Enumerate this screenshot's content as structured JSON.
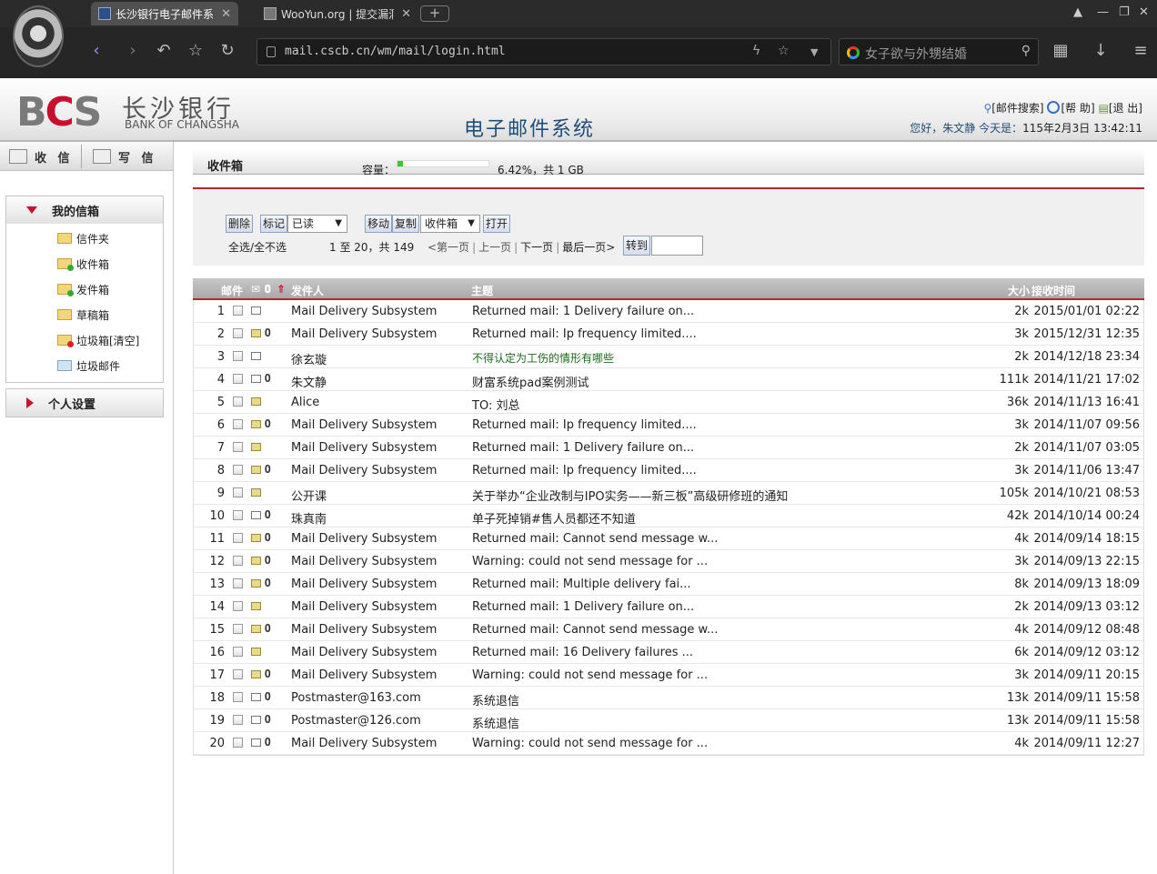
{
  "browser": {
    "tabs": [
      {
        "title": "长沙银行电子邮件系统",
        "active": true
      },
      {
        "title": "WooYun.org | 提交漏洞",
        "active": false
      }
    ],
    "url": "mail.cscb.cn/wm/mail/login.html",
    "search_text": "女子欲与外甥结婚"
  },
  "header": {
    "logo_en": "BANK OF CHANGSHA",
    "logo_cn": "长沙银行",
    "logo_bcs": "BCS",
    "system_title": "电子邮件系统",
    "links": {
      "search": "[邮件搜索]",
      "help": "[帮 助]",
      "logout": "[退 出]"
    },
    "greeting": "您好，朱文静 今天是：",
    "date": "115年2月3日 13:42:11"
  },
  "sidebar": {
    "receive": "收 信",
    "compose": "写 信",
    "mybox_title": "我的信箱",
    "folders": [
      {
        "label": "信件夹",
        "kind": "plain"
      },
      {
        "label": "收件箱",
        "kind": "green"
      },
      {
        "label": "发件箱",
        "kind": "green"
      },
      {
        "label": "草稿箱",
        "kind": "plain"
      },
      {
        "label": "垃圾箱[清空]",
        "kind": "red"
      },
      {
        "label": "垃圾邮件",
        "kind": "blue"
      }
    ],
    "settings_title": "个人设置"
  },
  "main": {
    "title": "收件箱",
    "capacity_label": "容量：",
    "capacity_percent": 6.42,
    "capacity_text": "6.42%，共 1 GB",
    "toolbar": {
      "delete": "删除",
      "mark": "标记",
      "mark_option": "已读",
      "move": "移动",
      "copy": "复制",
      "folder_option": "收件箱",
      "open": "打开",
      "select_all": "全选/全不选",
      "range": "1 至 20，共 149",
      "first": "<第一页",
      "prev": "上一页",
      "next": "下一页",
      "last": "最后一页>",
      "goto": "转到"
    },
    "columns": {
      "mail": "邮件",
      "sender": "发件人",
      "subject": "主题",
      "size": "大小",
      "time": "接收时间"
    },
    "rows": [
      {
        "n": "1",
        "read": true,
        "attach": false,
        "from": "Mail Delivery Subsystem",
        "subject": "Returned mail: 1 Delivery failure on...",
        "size": "2k",
        "time": "2015/01/01 02:22"
      },
      {
        "n": "2",
        "read": false,
        "attach": true,
        "from": "Mail Delivery Subsystem",
        "subject": "Returned mail: Ip frequency limited....",
        "size": "3k",
        "time": "2015/12/31 12:35"
      },
      {
        "n": "3",
        "read": true,
        "attach": false,
        "from": "徐玄璇",
        "subject": "不得认定为工伤的情形有哪些",
        "size": "2k",
        "time": "2014/12/18 23:34",
        "green": true
      },
      {
        "n": "4",
        "read": true,
        "attach": true,
        "from": "朱文静",
        "subject": "财富系统pad案例测试",
        "size": "111k",
        "time": "2014/11/21 17:02"
      },
      {
        "n": "5",
        "read": false,
        "attach": false,
        "from": "Alice",
        "subject": "TO: 刘总",
        "size": "36k",
        "time": "2014/11/13 16:41"
      },
      {
        "n": "6",
        "read": false,
        "attach": true,
        "from": "Mail Delivery Subsystem",
        "subject": "Returned mail: Ip frequency limited....",
        "size": "3k",
        "time": "2014/11/07 09:56"
      },
      {
        "n": "7",
        "read": false,
        "attach": false,
        "from": "Mail Delivery Subsystem",
        "subject": "Returned mail: 1 Delivery failure on...",
        "size": "2k",
        "time": "2014/11/07 03:05"
      },
      {
        "n": "8",
        "read": false,
        "attach": true,
        "from": "Mail Delivery Subsystem",
        "subject": "Returned mail: Ip frequency limited....",
        "size": "3k",
        "time": "2014/11/06 13:47"
      },
      {
        "n": "9",
        "read": false,
        "attach": false,
        "from": "公开课",
        "subject": "关于举办“企业改制与IPO实务——新三板”高级研修班的通知",
        "size": "105k",
        "time": "2014/10/21 08:53"
      },
      {
        "n": "10",
        "read": true,
        "attach": true,
        "from": "珠真南",
        "subject": "单子死掉销#售人员都还不知道",
        "size": "42k",
        "time": "2014/10/14 00:24"
      },
      {
        "n": "11",
        "read": false,
        "attach": true,
        "from": "Mail Delivery Subsystem",
        "subject": "Returned mail: Cannot send message w...",
        "size": "4k",
        "time": "2014/09/14 18:15"
      },
      {
        "n": "12",
        "read": false,
        "attach": true,
        "from": "Mail Delivery Subsystem",
        "subject": "Warning: could not send message for ...",
        "size": "3k",
        "time": "2014/09/13 22:15"
      },
      {
        "n": "13",
        "read": false,
        "attach": true,
        "from": "Mail Delivery Subsystem",
        "subject": "Returned mail: Multiple delivery fai...",
        "size": "8k",
        "time": "2014/09/13 18:09"
      },
      {
        "n": "14",
        "read": false,
        "attach": false,
        "from": "Mail Delivery Subsystem",
        "subject": "Returned mail: 1 Delivery failure on...",
        "size": "2k",
        "time": "2014/09/13 03:12"
      },
      {
        "n": "15",
        "read": false,
        "attach": true,
        "from": "Mail Delivery Subsystem",
        "subject": "Returned mail: Cannot send message w...",
        "size": "4k",
        "time": "2014/09/12 08:48"
      },
      {
        "n": "16",
        "read": false,
        "attach": false,
        "from": "Mail Delivery Subsystem",
        "subject": "Returned mail: 16 Delivery failures ...",
        "size": "6k",
        "time": "2014/09/12 03:12"
      },
      {
        "n": "17",
        "read": false,
        "attach": true,
        "from": "Mail Delivery Subsystem",
        "subject": "Warning: could not send message for ...",
        "size": "3k",
        "time": "2014/09/11 20:15"
      },
      {
        "n": "18",
        "read": true,
        "attach": true,
        "from": "Postmaster@163.com",
        "subject": "系统退信",
        "size": "13k",
        "time": "2014/09/11 15:58"
      },
      {
        "n": "19",
        "read": true,
        "attach": true,
        "from": "Postmaster@126.com",
        "subject": "系统退信",
        "size": "13k",
        "time": "2014/09/11 15:58"
      },
      {
        "n": "20",
        "read": true,
        "attach": true,
        "from": "Mail Delivery Subsystem",
        "subject": "Warning: could not send message for ...",
        "size": "4k",
        "time": "2014/09/11 12:27"
      }
    ]
  }
}
